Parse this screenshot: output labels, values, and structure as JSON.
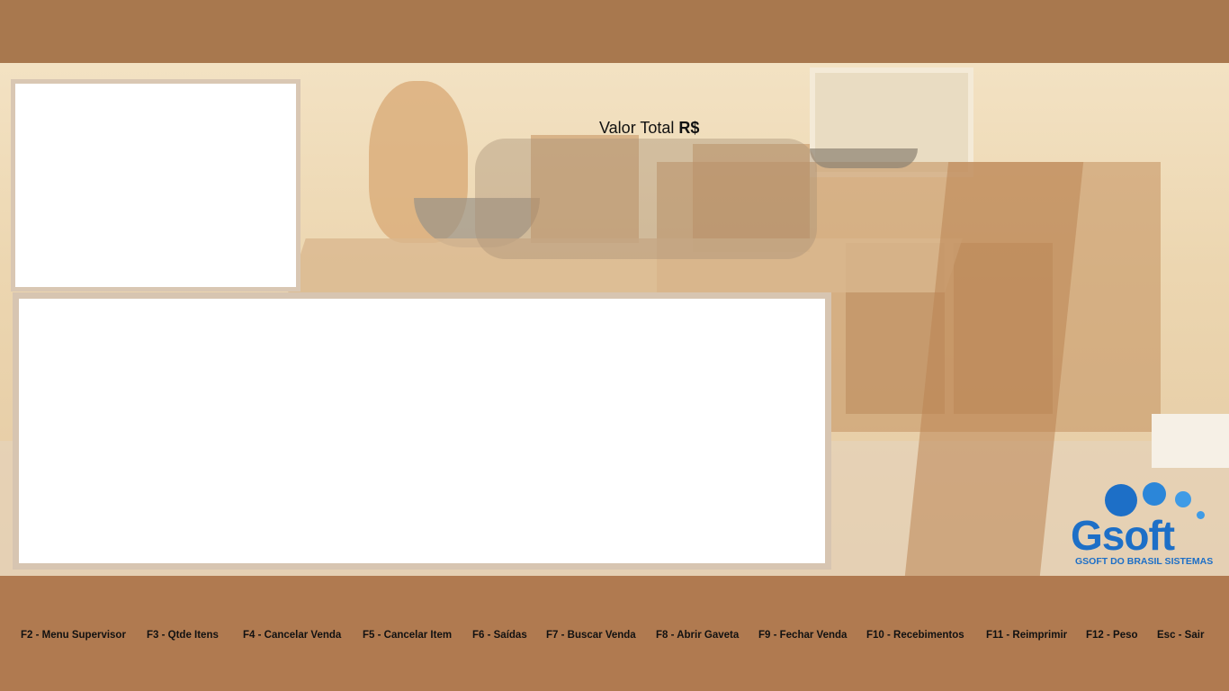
{
  "total": {
    "label": "Valor Total",
    "currency": "R$",
    "value": ""
  },
  "logo": {
    "brand": "Gsoft",
    "subtitle": "GSOFT DO BRASIL SISTEMAS",
    "color": "#1d6fc7"
  },
  "function_keys": [
    "F2 - Menu Supervisor",
    "F3 - Qtde Itens",
    "F4 - Cancelar Venda",
    "F5 - Cancelar Item",
    "F6 - Saídas",
    "F7 - Buscar Venda",
    "F8 - Abrir Gaveta",
    "F9 - Fechar Venda",
    "F10 - Recebimentos",
    "F11 - Reimprimir",
    "F12 - Peso",
    "Esc - Sair"
  ],
  "colors": {
    "frame_brown": "#b07a50",
    "panel_border": "#d9c7b3"
  }
}
